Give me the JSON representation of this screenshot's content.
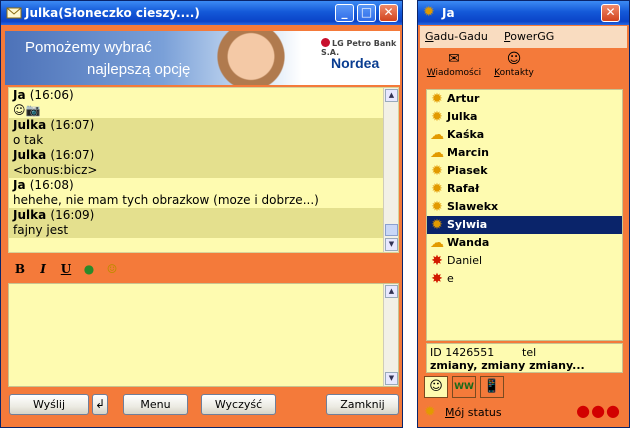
{
  "chat": {
    "title": "Julka(Słoneczko cieszy....)",
    "banner": {
      "slogan_line1": "Pomożemy wybrać",
      "slogan_line2": "najlepszą opcję",
      "bank": "LG Petro Bank S.A.",
      "brand": "Nordea"
    },
    "messages": [
      {
        "sender": "Ja",
        "time": "(16:06)",
        "text": "☺📷",
        "alt": false
      },
      {
        "sender": "Julka",
        "time": "(16:07)",
        "text": "o tak",
        "alt": true
      },
      {
        "sender": "Julka",
        "time": "(16:07)",
        "text": "<bonus:bicz>",
        "alt": true
      },
      {
        "sender": "Ja",
        "time": "(16:08)",
        "text": "hehehe, nie mam tych obrazkow (moze i dobrze...)",
        "alt": false
      },
      {
        "sender": "Julka",
        "time": "(16:09)",
        "text": "fajny jest",
        "alt": true
      }
    ],
    "format": {
      "bold": "B",
      "italic": "I",
      "underline": "U",
      "color": "●",
      "emoticon": "☺"
    },
    "input_value": "",
    "buttons": {
      "send": "Wyślij",
      "enter": "↲",
      "menu": "Menu",
      "clear": "Wyczyść",
      "close": "Zamknij"
    }
  },
  "contacts": {
    "title": "Ja",
    "menu": [
      {
        "first": "G",
        "rest": "adu-Gadu"
      },
      {
        "first": "P",
        "rest": "owerGG"
      }
    ],
    "tools": [
      {
        "icon": "✉",
        "first": "W",
        "rest": "iadomości"
      },
      {
        "icon": "☺",
        "first": "K",
        "rest": "ontakty"
      }
    ],
    "list": [
      {
        "name": "Artur",
        "status": "sun",
        "online": true,
        "selected": false
      },
      {
        "name": "Julka",
        "status": "sun-busy",
        "online": true,
        "selected": false
      },
      {
        "name": "Kaśka",
        "status": "cloud",
        "online": true,
        "selected": false
      },
      {
        "name": "Marcin",
        "status": "cloud",
        "online": true,
        "selected": false
      },
      {
        "name": "Piasek",
        "status": "sun",
        "online": true,
        "selected": false
      },
      {
        "name": "Rafał",
        "status": "sun",
        "online": true,
        "selected": false
      },
      {
        "name": "Slawekx",
        "status": "sun-busy",
        "online": true,
        "selected": false
      },
      {
        "name": "Sylwia",
        "status": "sun-busy",
        "online": true,
        "selected": true
      },
      {
        "name": "Wanda",
        "status": "cloud",
        "online": true,
        "selected": false
      },
      {
        "name": "Daniel",
        "status": "red",
        "online": false,
        "selected": false
      },
      {
        "name": "e",
        "status": "red",
        "online": false,
        "selected": false
      }
    ],
    "info": {
      "id_label": "ID 1426551",
      "tel_label": "tel",
      "description": "zmiany, zmiany zmiany..."
    },
    "tabs": [
      "☺",
      "WW",
      "📱"
    ],
    "status_first": "M",
    "status_rest": "ój status",
    "dots": "●●●"
  },
  "colors": {
    "accent": "#f47a3a",
    "panel": "#fefbb0",
    "selection": "#0a246a",
    "title": "#1459d8"
  }
}
